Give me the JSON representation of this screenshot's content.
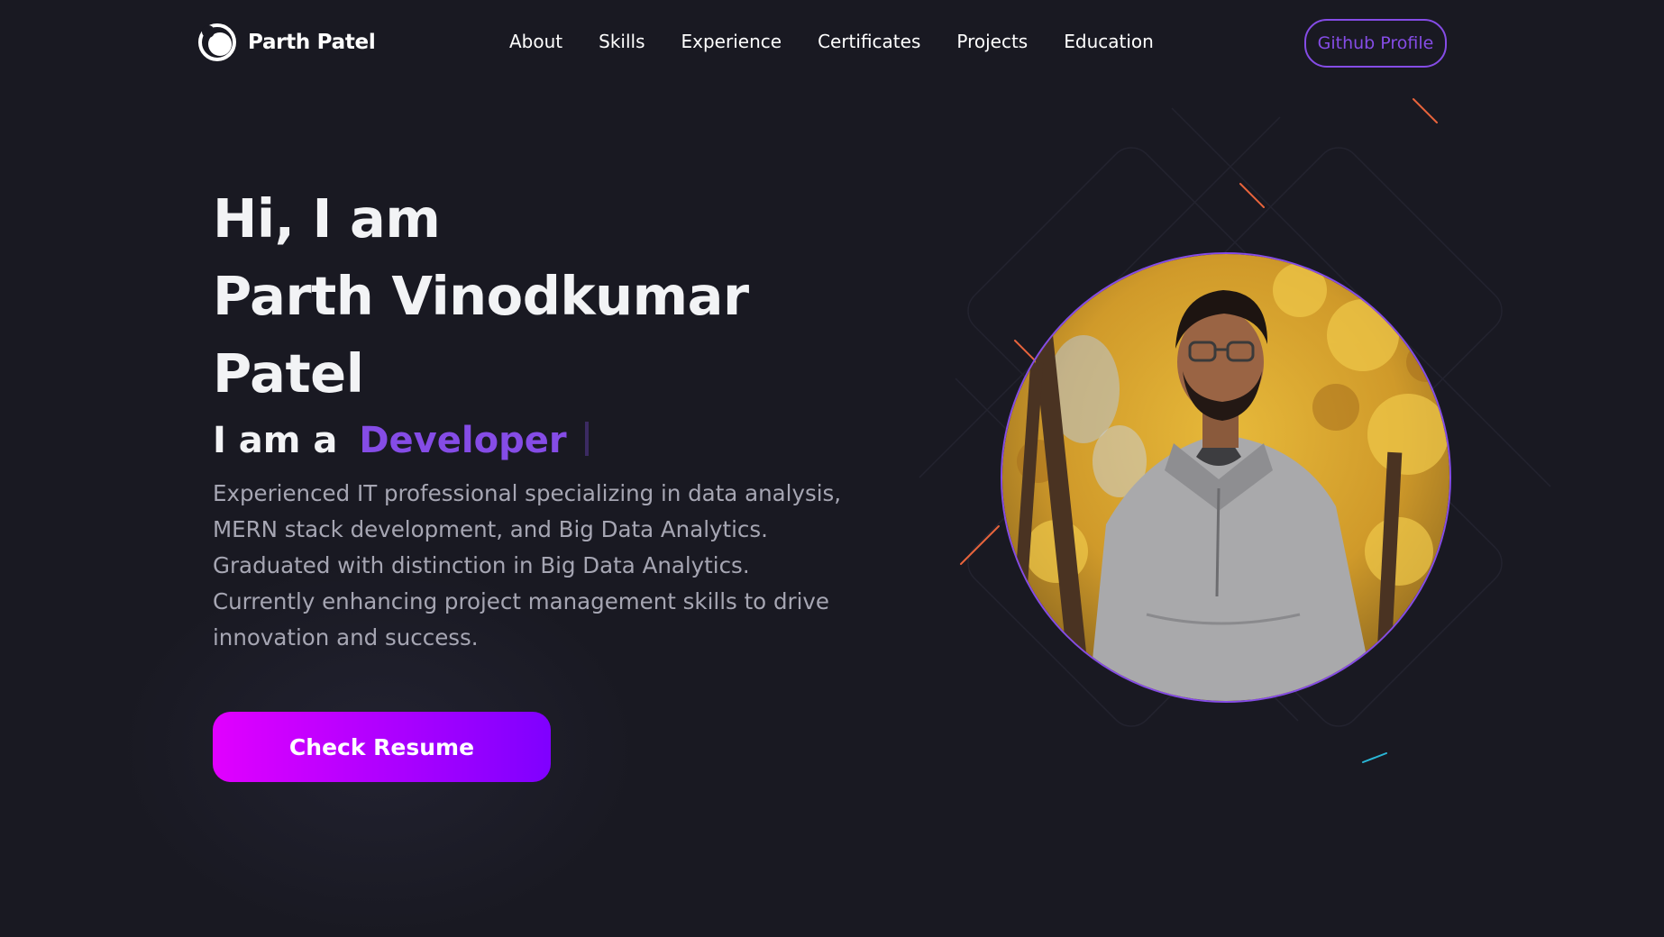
{
  "nav": {
    "logo_text": "Parth Patel",
    "links": [
      "About",
      "Skills",
      "Experience",
      "Certificates",
      "Projects",
      "Education"
    ],
    "github_label": "Github Profile"
  },
  "hero": {
    "title_lines": [
      "Hi, I am",
      "Parth Vinodkumar",
      "Patel"
    ],
    "role_prefix": "I am a",
    "role_word": "Developer",
    "description": "Experienced IT professional specializing in data analysis, MERN stack development, and Big Data Analytics. Graduated with distinction in Big Data Analytics. Currently enhancing project management skills to drive innovation and success.",
    "resume_label": "Check Resume"
  },
  "colors": {
    "background": "#191922",
    "accent": "#854ce6",
    "text_primary": "#f2f3f5",
    "text_secondary": "#a6a6b3",
    "button_gradient_start": "#e100ff",
    "button_gradient_end": "#7f00ff"
  },
  "icons": {
    "logo": "logo-icon"
  }
}
